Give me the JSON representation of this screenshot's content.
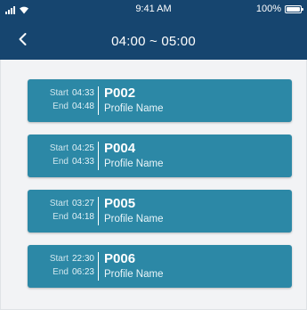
{
  "status_bar": {
    "time": "9:41 AM",
    "battery": "100%",
    "battery_level": 1.0
  },
  "nav": {
    "title": "04:00 ~ 05:00",
    "back_icon": "chevron-left-icon"
  },
  "labels": {
    "start": "Start",
    "end": "End"
  },
  "items": [
    {
      "start": "04:33",
      "end": "04:48",
      "id": "P002",
      "name": "Profile Name"
    },
    {
      "start": "04:25",
      "end": "04:33",
      "id": "P004",
      "name": "Profile Name"
    },
    {
      "start": "03:27",
      "end": "04:18",
      "id": "P005",
      "name": "Profile Name"
    },
    {
      "start": "22:30",
      "end": "06:23",
      "id": "P006",
      "name": "Profile Name"
    }
  ],
  "colors": {
    "header": "#16456f",
    "card": "#2c88a6",
    "background": "#f2f3f5"
  }
}
